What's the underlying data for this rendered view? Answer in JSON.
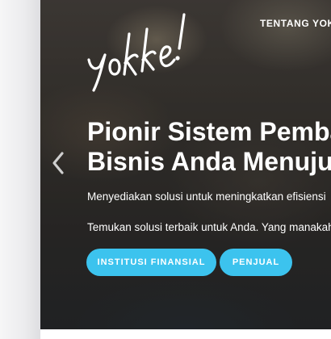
{
  "nav": {
    "link_label": "TENTANG YOKKE"
  },
  "logo": {
    "text": "Yokke!"
  },
  "hero": {
    "title_line1": "Pionir Sistem Pembayaran",
    "title_line2": "Bisnis Anda Menuju",
    "subtitle": "Menyediakan solusi untuk meningkatkan efisiensi",
    "subtitle2": "Temukan solusi terbaik untuk Anda. Yang manakah",
    "prev_icon": "chevron-left-icon"
  },
  "buttons": {
    "institusi_label": "INSTITUSI FINANSIAL",
    "penjual_label": "PENJUAL"
  },
  "colors": {
    "accent": "#3cc3ee",
    "hero_overlay": "#2f2d2b",
    "text": "#ffffff"
  }
}
